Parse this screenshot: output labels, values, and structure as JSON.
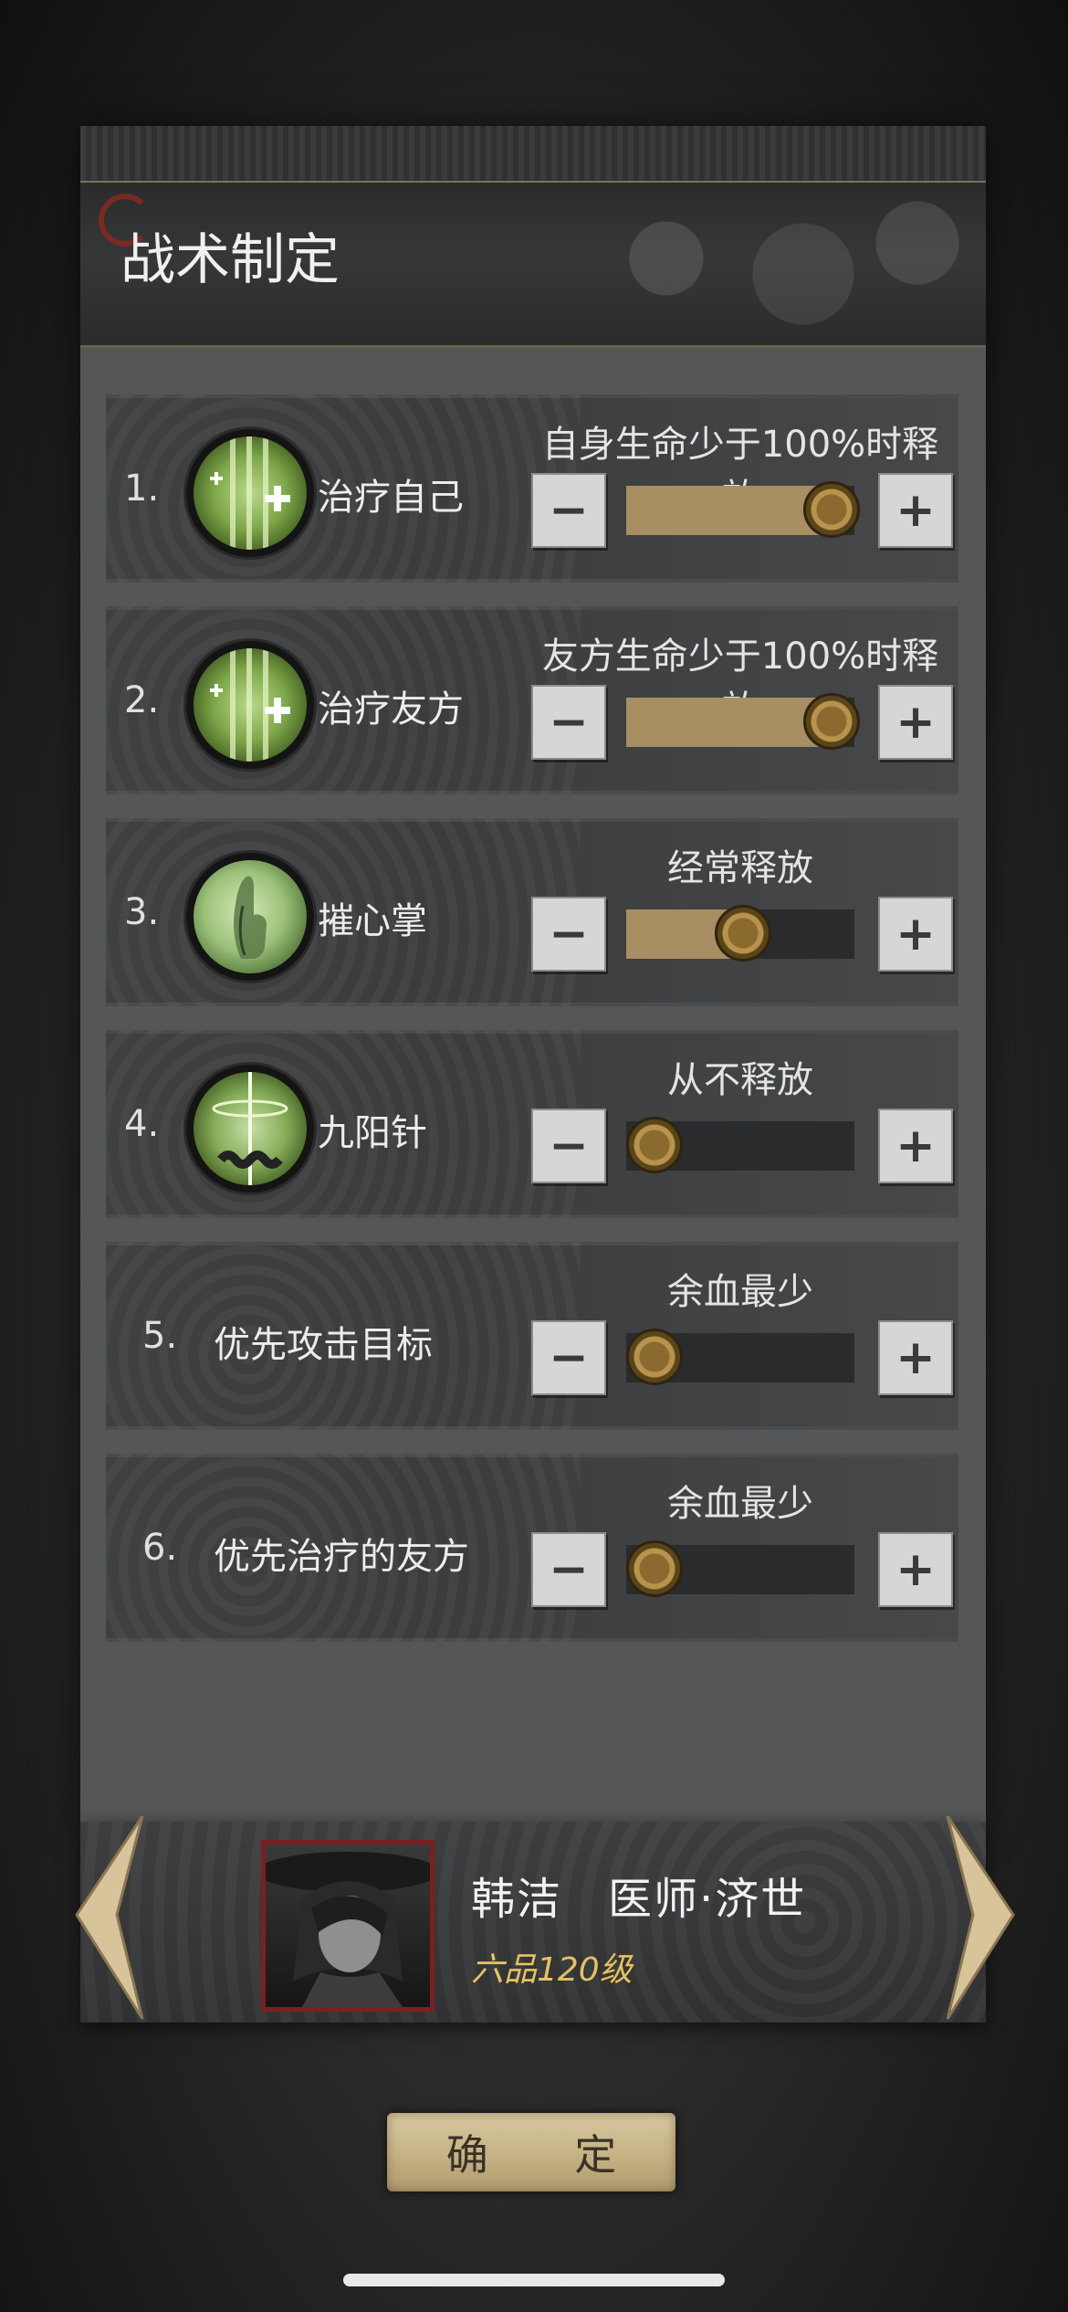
{
  "window": {
    "title": "战术制定"
  },
  "rules": [
    {
      "num": "1.",
      "skill": "治疗自己",
      "icon": "heal-cross-icon",
      "condition": "自身生命少于100%时释放",
      "level": 1.0
    },
    {
      "num": "2.",
      "skill": "治疗友方",
      "icon": "heal-cross-icon",
      "condition": "友方生命少于100%时释放",
      "level": 1.0
    },
    {
      "num": "3.",
      "skill": "摧心掌",
      "icon": "palm-strike-icon",
      "condition": "经常释放",
      "level": 0.5
    },
    {
      "num": "4.",
      "skill": "九阳针",
      "icon": "needle-icon",
      "condition": "从不释放",
      "level": 0.0
    },
    {
      "num": "5.",
      "skill": "优先攻击目标",
      "icon": "",
      "condition": "余血最少",
      "level": 0.0
    },
    {
      "num": "6.",
      "skill": "优先治疗的友方",
      "icon": "",
      "condition": "余血最少",
      "level": 0.0
    }
  ],
  "controls": {
    "minus": "−",
    "plus": "+"
  },
  "character": {
    "name": "韩洁　医师·济世",
    "rank": "六品120级"
  },
  "confirm_label": "确 定",
  "colors": {
    "slider_fill": "#a78e63",
    "rank_text": "#e7c25e",
    "accent_red": "#7a1f22"
  }
}
